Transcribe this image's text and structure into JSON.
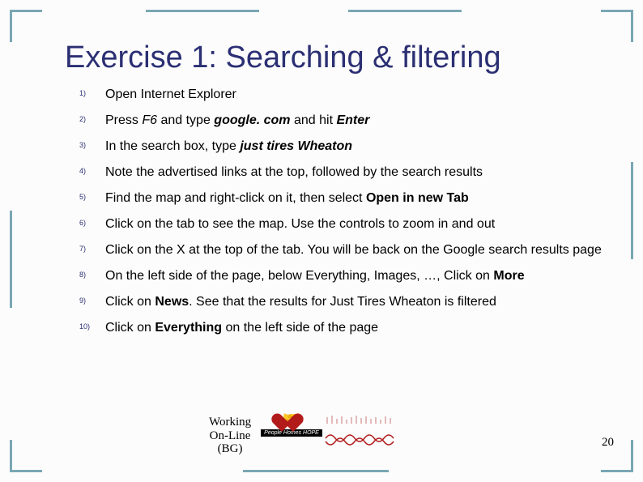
{
  "title": "Exercise 1: Searching & filtering",
  "steps": [
    {
      "n": "1)",
      "html": "Open Internet Explorer"
    },
    {
      "n": "2)",
      "html": "Press <i>F6</i> and type <b><i>google. com</i></b> and hit <b><i>Enter</i></b>"
    },
    {
      "n": "3)",
      "html": "In the search box, type <b><i>just tires Wheaton</i></b>"
    },
    {
      "n": "4)",
      "html": "Note the advertised links at the top, followed by the search results"
    },
    {
      "n": "5)",
      "html": "Find the map and right-click on it, then select <b>Open in new Tab</b>"
    },
    {
      "n": "6)",
      "html": "Click on the tab to see the map. Use the controls to zoom in and out"
    },
    {
      "n": "7)",
      "html": "Click on the X at the top of the tab. You will be back on the Google search results page"
    },
    {
      "n": "8)",
      "html": "On the left side of the page, below Everything, Images, …, Click on <b>More</b>"
    },
    {
      "n": "9)",
      "html": "Click on <b>News</b>. See that the results for Just Tires Wheaton is filtered"
    },
    {
      "n": "10)",
      "html": "Click on <b>Everything</b> on the left side of the page"
    }
  ],
  "footer": {
    "title_line1": "Working",
    "title_line2": "On-Line",
    "title_line3": "(BG)",
    "logo_tag": "People Homes HOPE"
  },
  "page_number": "20"
}
